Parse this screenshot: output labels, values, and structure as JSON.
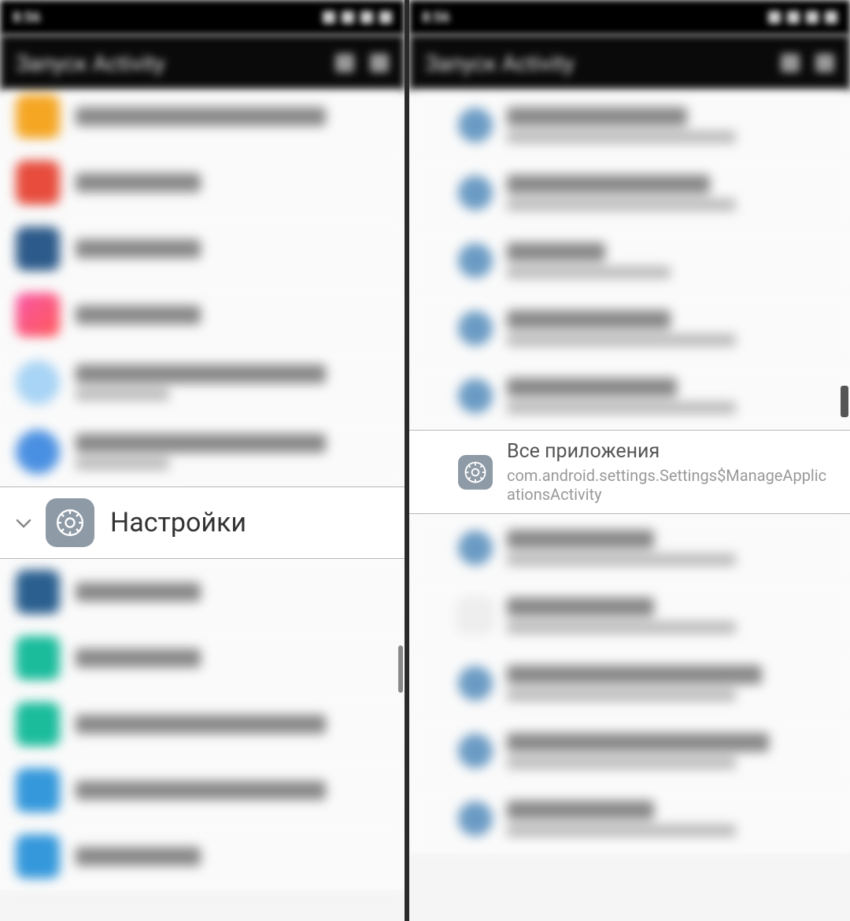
{
  "statusbar": {
    "time": "8:56"
  },
  "titlebar": {
    "title": "Запуск Activity"
  },
  "left": {
    "focused": {
      "title": "Настройки"
    },
    "blurred_items": [
      {
        "icon": "orange",
        "width": "long"
      },
      {
        "icon": "red-download",
        "width": "short"
      },
      {
        "icon": "blue-dark",
        "width": "short"
      },
      {
        "icon": "pink",
        "width": "short"
      },
      {
        "icon": "lightblue",
        "width": "long",
        "twoline": true
      },
      {
        "icon": "blue",
        "width": "long",
        "twoline": true
      }
    ],
    "blurred_below": [
      {
        "icon": "darkblue",
        "width": "short"
      },
      {
        "icon": "teal",
        "width": "short"
      },
      {
        "icon": "teal",
        "width": "long"
      },
      {
        "icon": "skyblue",
        "width": "long"
      },
      {
        "icon": "skyblue",
        "width": "short"
      }
    ]
  },
  "right": {
    "focused": {
      "title": "Все приложения",
      "subtitle": "com.android.settings.Settings$ManageApplicationsActivity"
    },
    "blurred_above_count": 5,
    "blurred_below_count": 5
  }
}
